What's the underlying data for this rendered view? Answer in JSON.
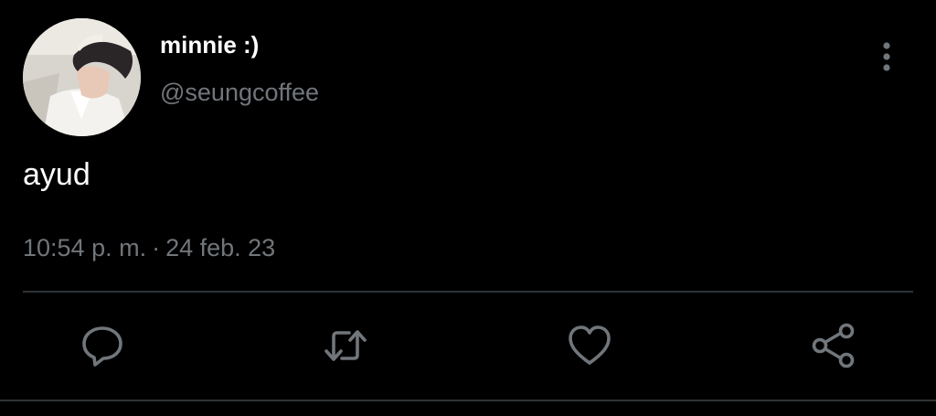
{
  "tweet": {
    "display_name": "minnie :)",
    "handle": "@seungcoffee",
    "text": "ayud",
    "time": "10:54 p. m.",
    "separator": "·",
    "date": "24 feb. 23"
  },
  "actions": {
    "reply": "reply-icon",
    "retweet": "retweet-icon",
    "like": "heart-icon",
    "share": "share-icon"
  },
  "colors": {
    "background": "#000000",
    "primary_text": "#ffffff",
    "secondary_text": "#71767b",
    "divider": "#2f3336"
  }
}
